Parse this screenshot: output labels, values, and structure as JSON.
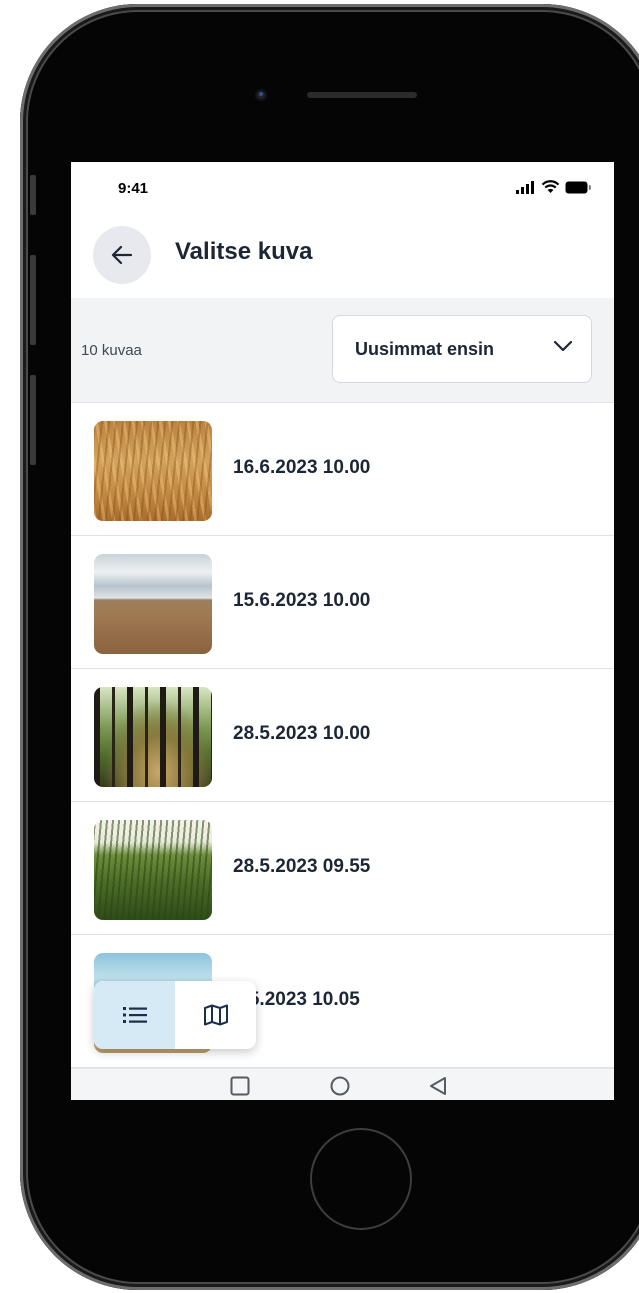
{
  "status_bar": {
    "time": "9:41"
  },
  "header": {
    "title": "Valitse kuva"
  },
  "toolbar": {
    "count_label": "10 kuvaa",
    "sort_label": "Uusimmat ensin"
  },
  "photos": [
    {
      "date": "16.6.2023 10.00"
    },
    {
      "date": "15.6.2023 10.00"
    },
    {
      "date": "28.5.2023 10.00"
    },
    {
      "date": "28.5.2023 09.55"
    },
    {
      "date": "7.5.2023 10.05"
    }
  ],
  "view_toggle": {
    "active": "list"
  },
  "colors": {
    "accent": "#d6eaf5",
    "title": "#1c2635",
    "toolbar_bg": "#f1f3f5"
  },
  "icons": [
    "back-arrow-icon",
    "chevron-down-icon",
    "list-icon",
    "map-icon",
    "signal-icon",
    "wifi-icon",
    "battery-icon",
    "square-nav-icon",
    "circle-nav-icon",
    "triangle-back-nav-icon"
  ]
}
